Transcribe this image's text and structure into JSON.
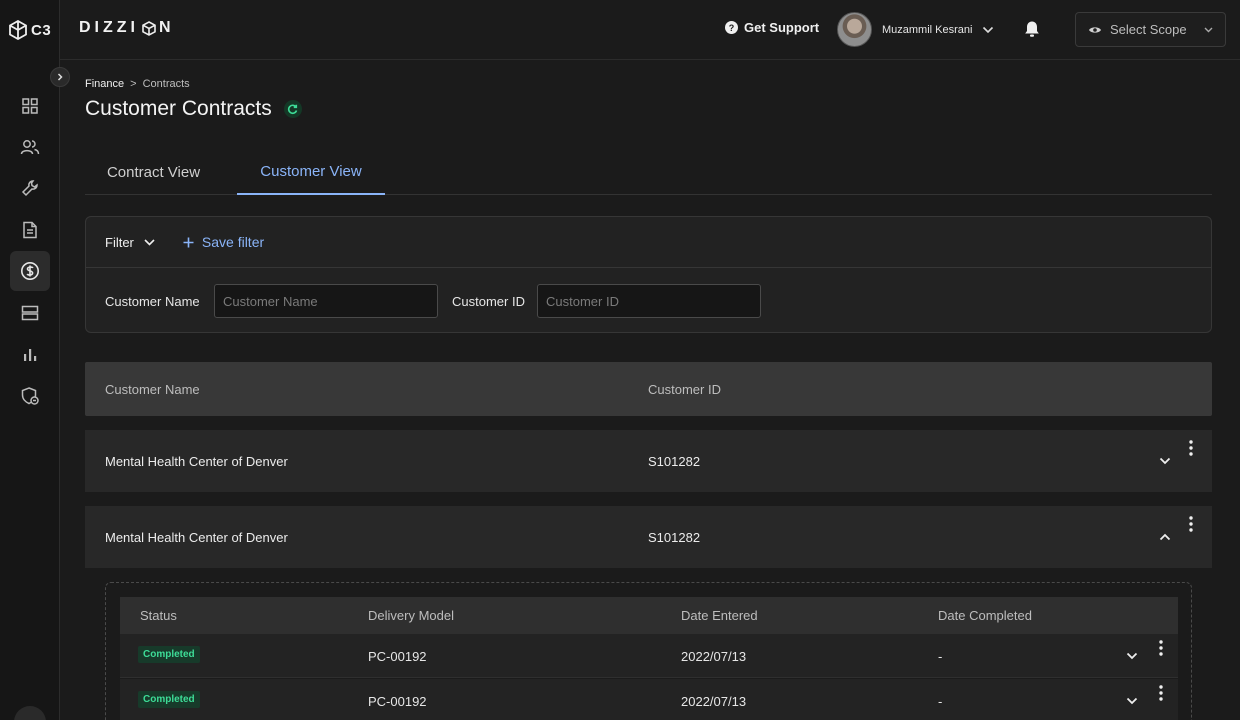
{
  "sidebar": {
    "logo_text": "C3",
    "items": [
      {
        "icon": "dashboard-grid-icon"
      },
      {
        "icon": "users-icon"
      },
      {
        "icon": "wrench-icon"
      },
      {
        "icon": "document-icon"
      },
      {
        "icon": "dollar-icon",
        "active": true
      },
      {
        "icon": "server-icon"
      },
      {
        "icon": "bar-chart-icon"
      },
      {
        "icon": "shield-icon"
      }
    ]
  },
  "header": {
    "brand": "DIZZI",
    "brand_suffix": "N",
    "support_label": "Get Support",
    "user_name": "Muzammil Kesrani",
    "scope_label": "Select Scope"
  },
  "breadcrumb": {
    "first": "Finance",
    "separator": ">",
    "second": "Contracts"
  },
  "page": {
    "title": "Customer Contracts"
  },
  "tabs": [
    {
      "label": "Contract View",
      "active": false
    },
    {
      "label": "Customer View",
      "active": true
    }
  ],
  "filter": {
    "filter_label": "Filter",
    "save_label": "Save filter",
    "customer_name_label": "Customer Name",
    "customer_name_placeholder": "Customer Name",
    "customer_id_label": "Customer ID",
    "customer_id_placeholder": "Customer ID"
  },
  "table": {
    "headers": [
      "Customer Name",
      "Customer ID"
    ],
    "rows": [
      {
        "name": "Mental Health Center of Denver",
        "id": "S101282",
        "expanded": false
      },
      {
        "name": "Mental Health Center of Denver",
        "id": "S101282",
        "expanded": true
      }
    ]
  },
  "subtable": {
    "headers": [
      "Status",
      "Delivery Model",
      "Date Entered",
      "Date Completed"
    ],
    "rows": [
      {
        "status": "Completed",
        "delivery_model": "PC-00192",
        "date_entered": "2022/07/13",
        "date_completed": "-"
      },
      {
        "status": "Completed",
        "delivery_model": "PC-00192",
        "date_entered": "2022/07/13",
        "date_completed": "-"
      }
    ]
  },
  "colors": {
    "accent": "#8ab4f8",
    "success": "#3ddc97",
    "background": "#1b1b1b"
  }
}
